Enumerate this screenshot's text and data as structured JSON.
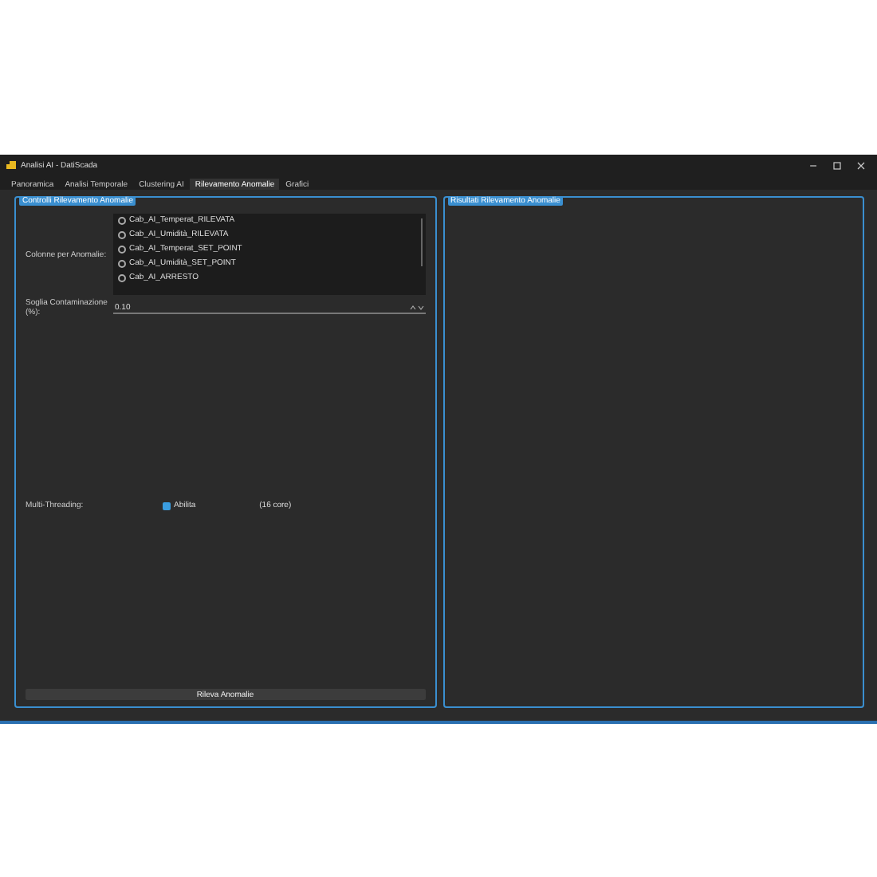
{
  "window": {
    "title": "Analisi AI - DatiScada"
  },
  "tabs": [
    {
      "label": "Panoramica",
      "selected": false
    },
    {
      "label": "Analisi Temporale",
      "selected": false
    },
    {
      "label": "Clustering AI",
      "selected": false
    },
    {
      "label": "Rilevamento Anomalie",
      "selected": true
    },
    {
      "label": "Grafici",
      "selected": false
    }
  ],
  "controls": {
    "title": "Controlli Rilevamento Anomalie",
    "columns_label": "Colonne per Anomalie:",
    "columns": [
      {
        "label": "Cab_AI_Temperat_RILEVATA",
        "checked": false
      },
      {
        "label": "Cab_AI_Umidità_RILEVATA",
        "checked": false
      },
      {
        "label": "Cab_AI_Temperat_SET_POINT",
        "checked": false
      },
      {
        "label": "Cab_AI_Umidità_SET_POINT",
        "checked": false
      },
      {
        "label": "Cab_AI_ARRESTO",
        "checked": false
      }
    ],
    "threshold_label": "Soglia Contaminazione (%):",
    "threshold_value": "0.10",
    "multithreading_label": "Multi-Threading:",
    "multithreading": {
      "label": "Abilita",
      "checked": true
    },
    "cores": "(16 core)",
    "button": "Rileva Anomalie"
  },
  "results": {
    "title": "Risultati Rilevamento Anomalie"
  }
}
